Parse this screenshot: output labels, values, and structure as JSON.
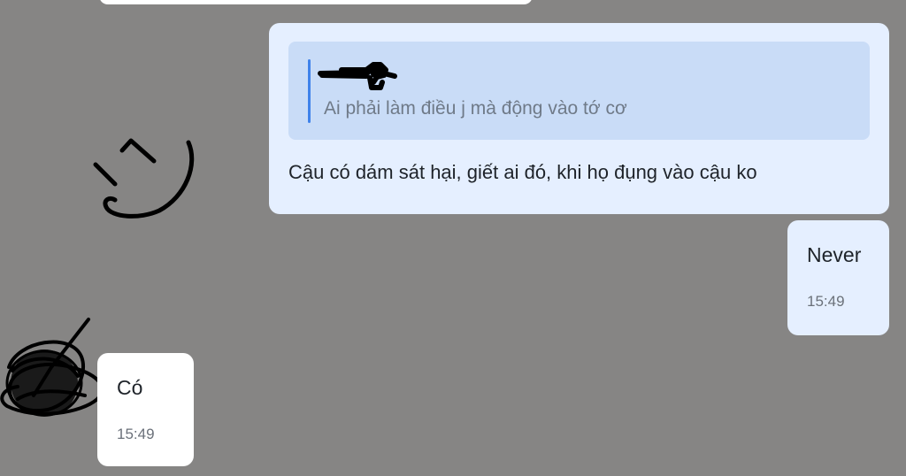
{
  "conversation": {
    "reply_message": {
      "quoted_text": "Ai phải làm điều j mà động vào tớ cơ",
      "text": "Cậu có dám sát hại, giết ai đó, khi họ đụng vào cậu ko"
    },
    "sent_message": {
      "text": "Never",
      "time": "15:49"
    },
    "received_message": {
      "text": "Có",
      "time": "15:49"
    }
  },
  "colors": {
    "background": "#868584",
    "my_bubble": "#e5efff",
    "their_bubble": "#ffffff",
    "quote_box": "#c9dcf7",
    "quote_bar": "#3f82ea"
  },
  "icons": {
    "avatar": "avatar-scribbled-out",
    "sender_name": "redacted-scribble",
    "sticker": "hand-drawn-smiley-doodle"
  }
}
